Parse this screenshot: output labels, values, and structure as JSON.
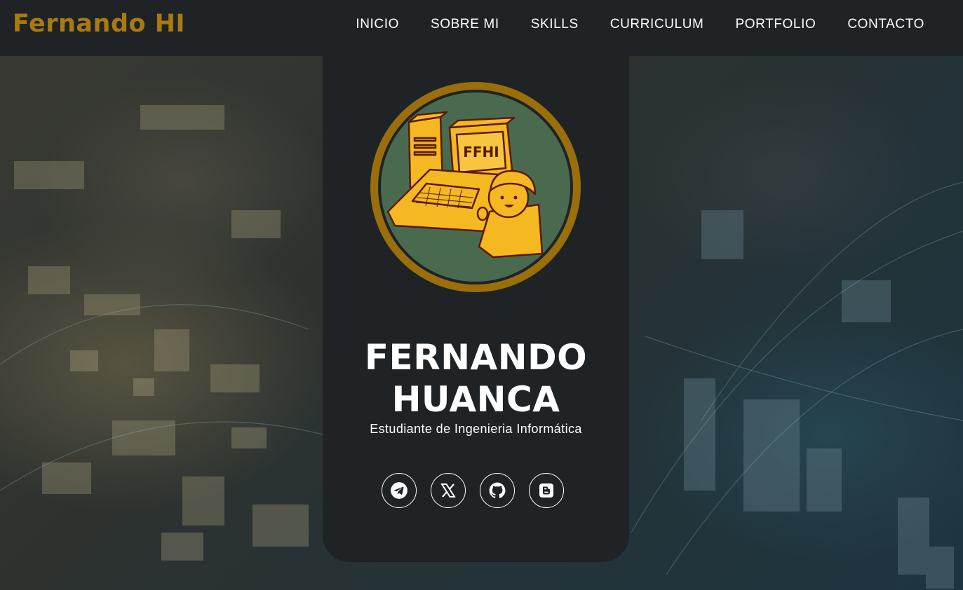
{
  "brand": {
    "logo_text": "Fernando HI",
    "color": "#a87a10"
  },
  "nav": {
    "items": [
      {
        "label": "INICIO"
      },
      {
        "label": "SOBRE MI"
      },
      {
        "label": "SKILLS"
      },
      {
        "label": "CURRICULUM"
      },
      {
        "label": "PORTFOLIO"
      },
      {
        "label": "CONTACTO"
      }
    ]
  },
  "profile": {
    "name_line1": "FERNANDO",
    "name_line2": "HUANCA",
    "subtitle": "Estudiante de Ingenieria Informática",
    "avatar_text": "FFHI"
  },
  "socials": [
    {
      "icon": "telegram-icon"
    },
    {
      "icon": "x-icon"
    },
    {
      "icon": "github-icon"
    },
    {
      "icon": "blogger-icon"
    }
  ],
  "colors": {
    "background": "#1f2326",
    "accent": "#a87a10",
    "avatar_bg": "#4a6a4f",
    "illustration": "#f5b820"
  }
}
